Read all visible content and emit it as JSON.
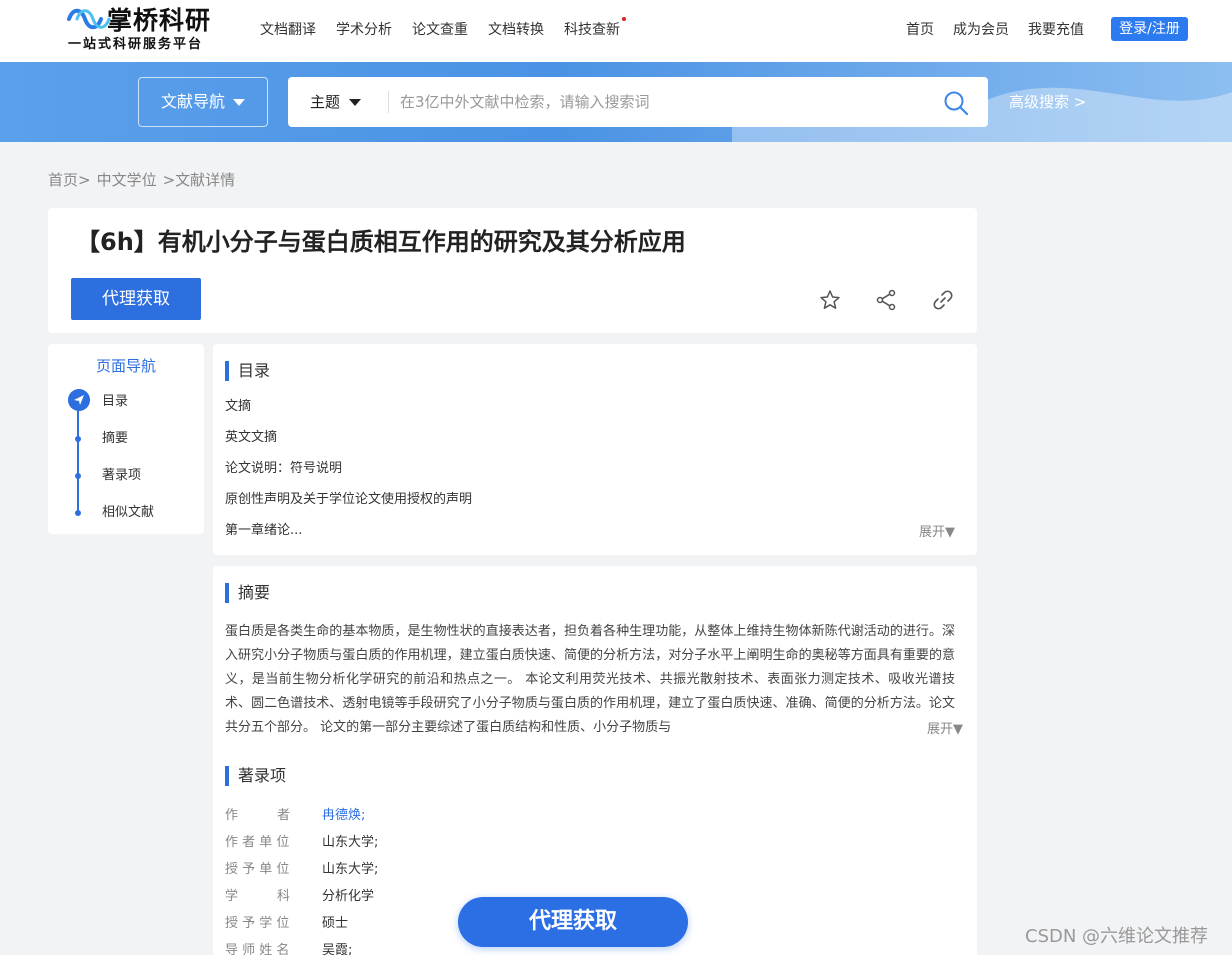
{
  "header": {
    "logo_title": "掌桥科研",
    "logo_subtitle": "一站式科研服务平台",
    "nav": [
      "文档翻译",
      "学术分析",
      "论文查重",
      "文档转换",
      "科技查新"
    ],
    "right_links": [
      "首页",
      "成为会员",
      "我要充值"
    ],
    "login_label": "登录/注册"
  },
  "search": {
    "nav_dropdown": "文献导航",
    "field": "主题",
    "placeholder": "在3亿中外文献中检索，请输入搜索词",
    "advanced": "高级搜索 >"
  },
  "breadcrumb": [
    "首页>",
    "中文学位",
    ">文献详情"
  ],
  "document": {
    "title": "【6h】有机小分子与蛋白质相互作用的研究及其分析应用",
    "proxy_label": "代理获取"
  },
  "page_nav": {
    "title": "页面导航",
    "items": [
      "目录",
      "摘要",
      "著录项",
      "相似文献"
    ]
  },
  "toc": {
    "heading": "目录",
    "items": [
      "文摘",
      "英文文摘",
      "论文说明：符号说明",
      "原创性声明及关于学位论文使用授权的声明",
      "第一章绪论..."
    ],
    "expand": "展开▼"
  },
  "abstract": {
    "heading": "摘要",
    "text": "蛋白质是各类生命的基本物质，是生物性状的直接表达者，担负着各种生理功能，从整体上维持生物体新陈代谢活动的进行。深入研究小分子物质与蛋白质的作用机理，建立蛋白质快速、简便的分析方法，对分子水平上阐明生命的奥秘等方面具有重要的意义，是当前生物分析化学研究的前沿和热点之一。 本论文利用荧光技术、共振光散射技术、表面张力测定技术、吸收光谱技术、圆二色谱技术、透射电镜等手段研究了小分子物质与蛋白质的作用机理，建立了蛋白质快速、准确、简便的分析方法。论文共分五个部分。 论文的第一部分主要综述了蛋白质结构和性质、小分子物质与",
    "expand": "展开▼"
  },
  "record": {
    "heading": "著录项",
    "rows": [
      {
        "label": "作　　　者",
        "value": "冉德焕;"
      },
      {
        "label": "作 者 单 位",
        "value": "山东大学;"
      },
      {
        "label": "授 予 单 位",
        "value": "山东大学;"
      },
      {
        "label": "学　　　科",
        "value": "分析化学"
      },
      {
        "label": "授 予 学 位",
        "value": "硕士"
      },
      {
        "label": "导 师 姓 名",
        "value": "吴霞;"
      }
    ]
  },
  "float_button": "代理获取",
  "watermark": "CSDN @六维论文推荐",
  "colors": {
    "accent": "#2e6fe0",
    "band": "#4a92e4",
    "background": "#f2f3f5"
  }
}
